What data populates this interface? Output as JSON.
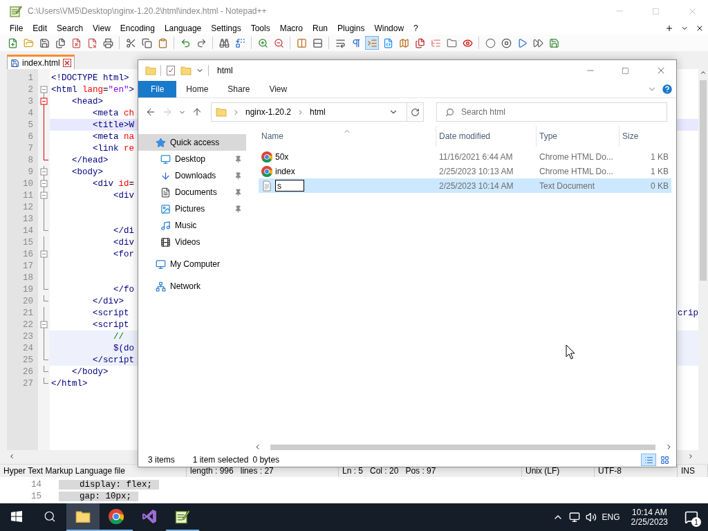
{
  "notepad": {
    "title": "C:\\Users\\VM5\\Desktop\\nginx-1.20.2\\html\\index.html - Notepad++",
    "menu": [
      "File",
      "Edit",
      "Search",
      "View",
      "Encoding",
      "Language",
      "Settings",
      "Tools",
      "Macro",
      "Run",
      "Plugins",
      "Window",
      "?"
    ],
    "toolbar": [
      {
        "pressed": false
      },
      {
        "pressed": false
      },
      {
        "pressed": false
      },
      {
        "pressed": false
      },
      {
        "pressed": false
      },
      {
        "pressed": false
      },
      {
        "pressed": false
      },
      {
        "pressed": false
      },
      {
        "pressed": false
      },
      {
        "pressed": false
      },
      {
        "pressed": false
      },
      {
        "pressed": false
      },
      {
        "pressed": false
      },
      {
        "pressed": false
      },
      {
        "pressed": false
      },
      {
        "pressed": false
      },
      {
        "pressed": false
      },
      {
        "pressed": false
      },
      {
        "pressed": false
      },
      {
        "pressed": false
      },
      {
        "pressed": true
      },
      {
        "pressed": false
      },
      {
        "pressed": false
      },
      {
        "pressed": false
      },
      {
        "pressed": false
      },
      {
        "pressed": false
      },
      {
        "pressed": false
      },
      {
        "pressed": false
      },
      {
        "pressed": false
      },
      {
        "pressed": false
      },
      {
        "pressed": false
      },
      {
        "pressed": false
      }
    ],
    "tabs": [
      {
        "label": "index.html",
        "selected": true
      }
    ],
    "lines": [
      {
        "n": "1",
        "code": "<!DOCTYPE html>",
        "kind": "plain",
        "current": false,
        "shaded": false
      },
      {
        "n": "2",
        "code": "<html lang=\"en\">",
        "kind": "open",
        "fold_active": false,
        "current": false,
        "shaded": false
      },
      {
        "n": "3",
        "code": "    <head>",
        "kind": "open",
        "fold_active": true,
        "current": false,
        "shaded": false
      },
      {
        "n": "4",
        "code": "        <meta ch",
        "kind": "line",
        "fold_active": true,
        "current": false,
        "shaded": false
      },
      {
        "n": "5",
        "code": "        <title>W",
        "kind": "line",
        "fold_active": true,
        "current": true,
        "shaded": false
      },
      {
        "n": "6",
        "code": "        <meta na",
        "kind": "line",
        "fold_active": true,
        "current": false,
        "shaded": false
      },
      {
        "n": "7",
        "code": "        <link re",
        "kind": "line",
        "fold_active": true,
        "current": false,
        "shaded": false
      },
      {
        "n": "8",
        "code": "    </head>",
        "kind": "end",
        "fold_active": true,
        "current": false,
        "shaded": false
      },
      {
        "n": "9",
        "code": "    <body>",
        "kind": "open",
        "fold_active": false,
        "current": false,
        "shaded": false
      },
      {
        "n": "10",
        "code": "        <div id=",
        "kind": "open",
        "fold_active": false,
        "current": false,
        "shaded": false
      },
      {
        "n": "11",
        "code": "            <div",
        "kind": "open",
        "fold_active": false,
        "current": false,
        "shaded": false
      },
      {
        "n": "12",
        "kind": "line",
        "fold_active": false,
        "current": false,
        "shaded": false
      },
      {
        "n": "13",
        "kind": "line",
        "fold_active": false,
        "current": false,
        "shaded": false
      },
      {
        "n": "14",
        "code": "            </di",
        "kind": "end",
        "fold_active": false,
        "current": false,
        "shaded": false
      },
      {
        "n": "15",
        "code": "            <div",
        "kind": "line",
        "fold_active": false,
        "current": false,
        "shaded": false
      },
      {
        "n": "16",
        "code": "            <for",
        "kind": "open",
        "fold_active": false,
        "current": false,
        "shaded": false
      },
      {
        "n": "17",
        "kind": "line",
        "fold_active": false,
        "current": false,
        "shaded": false
      },
      {
        "n": "18",
        "kind": "line",
        "fold_active": false,
        "current": false,
        "shaded": false
      },
      {
        "n": "19",
        "code": "            </fo",
        "kind": "end",
        "fold_active": false,
        "current": false,
        "shaded": false
      },
      {
        "n": "20",
        "code": "        </div>",
        "kind": "end",
        "fold_active": false,
        "current": false,
        "shaded": false
      },
      {
        "n": "21",
        "code": "        <script",
        "tail": "crip",
        "kind": "line",
        "fold_active": false,
        "current": false,
        "shaded": false
      },
      {
        "n": "22",
        "code": "        <script",
        "kind": "open",
        "fold_active": false,
        "current": false,
        "shaded": false
      },
      {
        "n": "23",
        "code": "            //",
        "kind": "line",
        "fold_active": false,
        "current": false,
        "shaded": true
      },
      {
        "n": "24",
        "code": "            $(do",
        "kind": "line",
        "fold_active": false,
        "current": false,
        "shaded": true
      },
      {
        "n": "25",
        "code": "        </script",
        "kind": "end",
        "fold_active": false,
        "current": false,
        "shaded": true
      },
      {
        "n": "26",
        "code": "    </body>",
        "kind": "end",
        "fold_active": false,
        "current": false,
        "shaded": false
      },
      {
        "n": "27",
        "code": "</html>",
        "kind": "end",
        "fold_active": false,
        "current": false,
        "shaded": false
      }
    ],
    "status_bar": [
      [
        "Hyper Text Markup Language file"
      ],
      [
        "length : 996",
        "lines : 27"
      ],
      [
        "Ln : 5",
        "Col : 20",
        "Pos : 97"
      ],
      [
        "Unix (LF)"
      ],
      [
        "UTF-8"
      ],
      [
        "INS"
      ]
    ]
  },
  "background_editor": {
    "lines": [
      {
        "n": "14",
        "code": "    display: flex;"
      },
      {
        "n": "15",
        "code": "    gap: 10px;"
      }
    ]
  },
  "explorer": {
    "title": "html",
    "ribbon_tabs": [
      {
        "label": "File",
        "selected": true
      },
      {
        "label": "Home",
        "selected": false
      },
      {
        "label": "Share",
        "selected": false
      },
      {
        "label": "View",
        "selected": false
      }
    ],
    "path": [
      "nginx-1.20.2",
      "html"
    ],
    "search": {
      "placeholder": "Search html"
    },
    "nav": [
      {
        "label": "Quick access",
        "selected": true,
        "children": [
          {
            "label": "Desktop",
            "pinned": true,
            "selected": false
          },
          {
            "label": "Downloads",
            "pinned": true,
            "selected": false
          },
          {
            "label": "Documents",
            "pinned": true,
            "selected": false
          },
          {
            "label": "Pictures",
            "pinned": true,
            "selected": false
          },
          {
            "label": "Music",
            "pinned": false,
            "selected": false
          },
          {
            "label": "Videos",
            "pinned": false,
            "selected": false
          }
        ]
      },
      {
        "label": "My Computer",
        "selected": false
      },
      {
        "label": "Network",
        "selected": false
      }
    ],
    "columns": [
      "Name",
      "Date modified",
      "Type",
      "Size"
    ],
    "files": [
      {
        "name": "50x",
        "date": "11/16/2021 6:44 AM",
        "type": "Chrome HTML Do...",
        "size": "1 KB",
        "kind": "html",
        "selected": false,
        "renaming": false
      },
      {
        "name": "index",
        "date": "2/25/2023 10:13 AM",
        "type": "Chrome HTML Do...",
        "size": "1 KB",
        "kind": "html",
        "selected": false,
        "renaming": false
      },
      {
        "name": "s",
        "date": "2/25/2023 10:14 AM",
        "type": "Text Document",
        "size": "0 KB",
        "kind": "text",
        "selected": true,
        "renaming": true
      }
    ],
    "status": [
      "3 items",
      "1 item selected",
      "0 bytes"
    ],
    "views": [
      {
        "selected": true
      },
      {
        "selected": false
      }
    ]
  },
  "taskbar": {
    "apps": [
      {
        "active": true,
        "running": true
      },
      {
        "active": false,
        "running": true
      },
      {
        "active": false,
        "running": false
      },
      {
        "active": false,
        "running": true
      }
    ],
    "language": "ENG",
    "time": "10:14 AM",
    "date": "2/25/2023",
    "notifications": "1"
  }
}
